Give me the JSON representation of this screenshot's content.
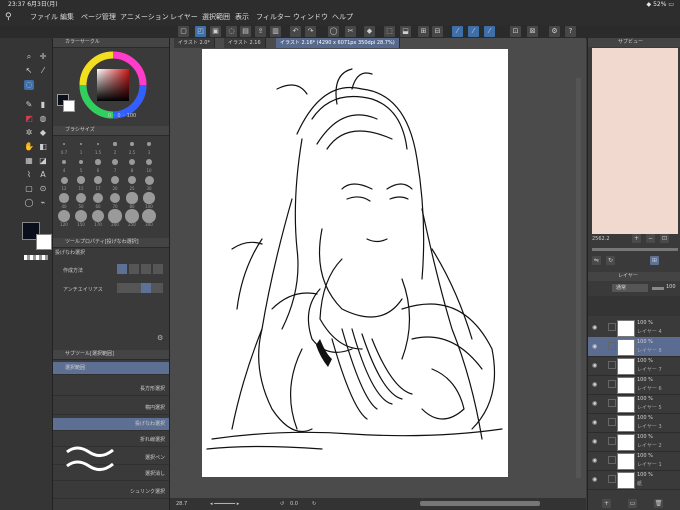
{
  "status": {
    "time": "23:37",
    "date": "6月3日(月)",
    "battery": "52%"
  },
  "menu": [
    "ファイル",
    "編集",
    "ページ管理",
    "アニメーション",
    "レイヤー",
    "選択範囲",
    "表示",
    "フィルター",
    "ウィンドウ",
    "ヘルプ"
  ],
  "color_panel": {
    "title": "カラーサークル",
    "value_a": "0",
    "value_b": "0",
    "value_c": "100"
  },
  "brush_size_panel": {
    "title": "ブラシサイズ",
    "sizes": [
      "0.7",
      "1",
      "1.5",
      "2",
      "2.5",
      "3",
      "4",
      "5",
      "6",
      "7",
      "8",
      "10",
      "12",
      "15",
      "17",
      "20",
      "25",
      "30",
      "40",
      "50",
      "60",
      "70",
      "80",
      "100",
      "120",
      "150",
      "170",
      "200",
      "250",
      "300"
    ]
  },
  "tool_property": {
    "title": "ツールプロパティ[投げなわ選択]",
    "subtitle": "投げなわ選択",
    "rows": [
      {
        "label": "作成方法"
      },
      {
        "label": "アンチエイリアス"
      }
    ]
  },
  "sub_tool": {
    "title": "サブツール[選択範囲]",
    "group": "選択範囲",
    "items": [
      "長方形選択",
      "楕円選択",
      "投げなわ選択",
      "折れ線選択",
      "選択ペン",
      "選択消し",
      "シュリンク選択"
    ],
    "selected_index": 2
  },
  "tabs": [
    "イラスト 2.0*",
    "イラスト 2.16",
    "イラスト 2.16* (4290 x 6071px 350dpi 28.7%)"
  ],
  "canvas_footer": {
    "zoom": "28.7",
    "angle": "0.0"
  },
  "navigator": {
    "title": "サブビュー",
    "zoom": "2562.2"
  },
  "layer_panel": {
    "title": "レイヤー",
    "blend": "通常",
    "opacity": "100",
    "layers": [
      {
        "pct": "100 %",
        "name": "レイヤー 4"
      },
      {
        "pct": "100 %",
        "name": "レイヤー 8"
      },
      {
        "pct": "100 %",
        "name": "レイヤー 7"
      },
      {
        "pct": "100 %",
        "name": "レイヤー 6"
      },
      {
        "pct": "100 %",
        "name": "レイヤー 5"
      },
      {
        "pct": "100 %",
        "name": "レイヤー 3"
      },
      {
        "pct": "100 %",
        "name": "レイヤー 2"
      },
      {
        "pct": "100 %",
        "name": "レイヤー 1"
      },
      {
        "pct": "100 %",
        "name": "紙"
      }
    ],
    "selected_index": 1
  },
  "colors": {
    "accent": "#3e6fa8",
    "selection": "#5a6c91",
    "subview_bg": "#f2d9d0"
  }
}
